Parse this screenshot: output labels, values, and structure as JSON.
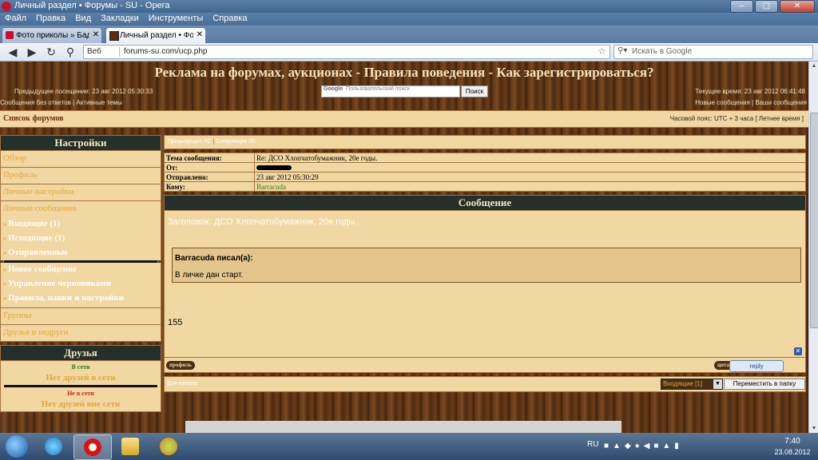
{
  "window": {
    "title": "Личный раздел • Форумы - SU - Opera"
  },
  "menu": [
    "Файл",
    "Правка",
    "Вид",
    "Закладки",
    "Инструменты",
    "Справка"
  ],
  "tabs": [
    {
      "label": "Фото приколы » Бада..."
    },
    {
      "label": "Личный раздел • Фор..."
    }
  ],
  "address": {
    "web_label": "Веб",
    "url": "forums-su.com/ucp.php",
    "search_placeholder": "Искать в Google"
  },
  "page": {
    "headline": "Реклама на форумах, аукционах - Правила поведения - Как зарегистрироваться?",
    "last_visit": "Предыдущее посещение: 23 авг 2012 05:30:33",
    "current_time": "Текущее время: 23 авг 2012 06:41:48",
    "google_label": "Google",
    "search_placeholder": "Пользовательский поиск",
    "search_button": "Поиск",
    "links_left": "Сообщения без ответов  |  Активные темы",
    "links_right": "Новые сообщения  |  Ваши сообщения",
    "forum_index": "Список форумов",
    "timezone": "Часовой пояс: UTC + 3 часа [ Летнее время ]"
  },
  "sidebar": {
    "settings_title": "Настройки",
    "overview": "Обзор",
    "profile": "Профиль",
    "personal_settings": "Личные настройки",
    "pm": "Личные сообщения",
    "inbox": "Входящие (1)",
    "outbox": "Исходящие (1)",
    "sent": "Отправленные",
    "new_message": "Новое сообщение",
    "drafts": "Управление черновиками",
    "rules": "Правила, папки и настройки",
    "groups": "Группы",
    "friends_foes": "Друзья и недруги",
    "friends_title": "Друзья",
    "online": "В сети",
    "no_friends_online": "Нет друзей в сети",
    "offline": "Не в сети",
    "no_friends_offline": "Нет друзей вне сети"
  },
  "message": {
    "nav_prev": "Предыдущее ЛС",
    "nav_sep": "|",
    "nav_next": "Следующее ЛС",
    "subject_label": "Тема сообщения:",
    "subject_value": "Re: ДСО Хлопчатобумажник, 20е годы.",
    "from_label": "От:",
    "sent_label": "Отправлено:",
    "sent_value": "23 авг 2012 05:30:29",
    "to_label": "Кому:",
    "to_value": "Barracuda",
    "section_title": "Сообщение",
    "body_subject": "Заголовок: ДСО Хлопчатобумажник, 20е годы.",
    "quote_author": "Barracuda писал(а):",
    "quote_text": "В личке дан старт.",
    "body_text": "155",
    "profile_button": "профиль",
    "quote_button": "цитата",
    "reply_button": "reply",
    "top_link": "Для начала",
    "folder_select": "Входящие [1]",
    "move_button": "Переместить в папку"
  },
  "taskbar": {
    "lang": "RU",
    "time": "7:40",
    "date": "23.08.2012"
  }
}
